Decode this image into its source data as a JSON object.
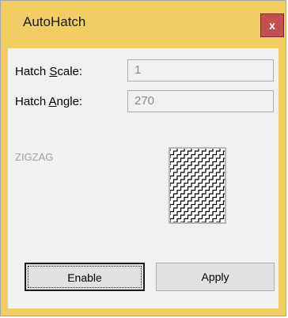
{
  "window": {
    "title": "AutoHatch",
    "close_label": "x"
  },
  "form": {
    "scale_label_pre": "Hatch ",
    "scale_label_accel": "S",
    "scale_label_post": "cale:",
    "scale_value": "1",
    "angle_label_pre": "Hatch ",
    "angle_label_accel": "A",
    "angle_label_post": "ngle:",
    "angle_value": "270"
  },
  "pattern": {
    "name": "ZIGZAG",
    "preview_icon": "zigzag-hatch-pattern"
  },
  "buttons": {
    "enable_label": "Enable",
    "apply_label": "Apply"
  },
  "colors": {
    "frame": "#f1cd64",
    "close": "#c45151"
  }
}
